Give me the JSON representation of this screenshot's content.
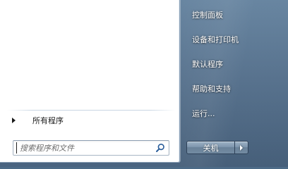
{
  "left_pane": {
    "all_programs": {
      "label": "所有程序",
      "arrow_icon": "triangle-right-icon"
    },
    "search": {
      "placeholder": "搜索程序和文件",
      "value": "",
      "icon": "search-icon"
    }
  },
  "right_pane": {
    "items": [
      {
        "label": "控制面板"
      },
      {
        "label": "设备和打印机"
      },
      {
        "label": "默认程序"
      },
      {
        "label": "帮助和支持"
      },
      {
        "label": "运行..."
      }
    ]
  },
  "shutdown": {
    "label": "关机",
    "arrow_icon": "triangle-right-icon"
  },
  "colors": {
    "menu_background": "#56728f",
    "left_pane_background": "#ffffff",
    "right_item_text": "#ffffff"
  }
}
